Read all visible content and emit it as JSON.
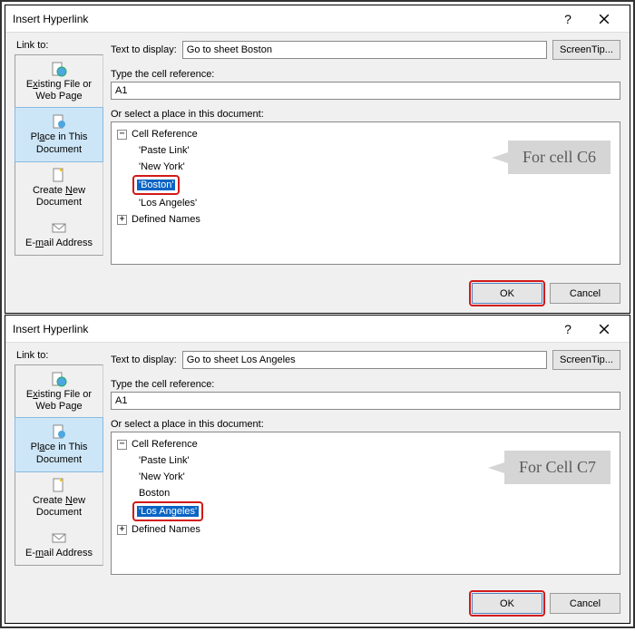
{
  "dialogs": [
    {
      "title": "Insert Hyperlink",
      "link_to_label": "Link to:",
      "sidebar": {
        "existing": "Existing File or\nWeb Page",
        "place": "Place in This\nDocument",
        "create": "Create New\nDocument",
        "email": "E-mail Address"
      },
      "text_to_display_label": "Text to display:",
      "text_to_display_value": "Go to sheet Boston",
      "screentip_label": "ScreenTip...",
      "ref_label": "Type the cell reference:",
      "ref_value": "A1",
      "place_label": "Or select a place in this document:",
      "tree": {
        "cell_ref": "Cell Reference",
        "sheets": [
          "'Paste Link'",
          "'New York'",
          "'Boston'",
          "'Los Angeles'"
        ],
        "selected_index": 2,
        "defined_names": "Defined Names"
      },
      "callout": "For cell C6",
      "ok": "OK",
      "cancel": "Cancel"
    },
    {
      "title": "Insert Hyperlink",
      "link_to_label": "Link to:",
      "sidebar": {
        "existing": "Existing File or\nWeb Page",
        "place": "Place in This\nDocument",
        "create": "Create New\nDocument",
        "email": "E-mail Address"
      },
      "text_to_display_label": "Text to display:",
      "text_to_display_value": "Go to sheet Los Angeles",
      "screentip_label": "ScreenTip...",
      "ref_label": "Type the cell reference:",
      "ref_value": "A1",
      "place_label": "Or select a place in this document:",
      "tree": {
        "cell_ref": "Cell Reference",
        "sheets": [
          "'Paste Link'",
          "'New York'",
          "Boston",
          "'Los Angeles'"
        ],
        "selected_index": 3,
        "defined_names": "Defined Names"
      },
      "callout": "For Cell C7",
      "ok": "OK",
      "cancel": "Cancel"
    }
  ]
}
